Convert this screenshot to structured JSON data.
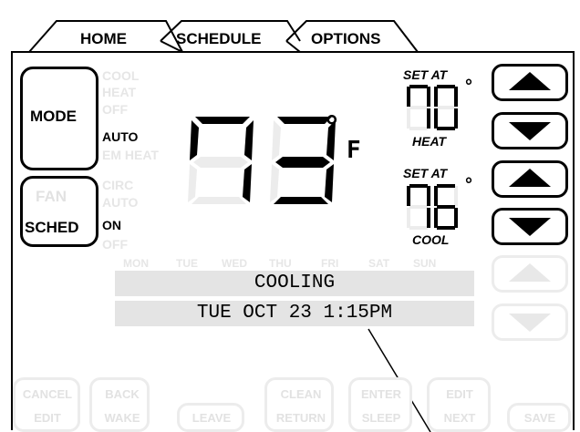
{
  "tabs": [
    {
      "label": "HOME"
    },
    {
      "label": "SCHEDULE"
    },
    {
      "label": "OPTIONS"
    }
  ],
  "mode": {
    "button_label": "MODE",
    "options": [
      "COOL",
      "HEAT",
      "OFF",
      "AUTO",
      "EM HEAT"
    ],
    "active": "AUTO"
  },
  "fan": {
    "button_label": "FAN",
    "options": [
      "CIRC",
      "AUTO",
      "ON",
      "OFF"
    ],
    "active": "ON"
  },
  "sched": {
    "button_label": "SCHED"
  },
  "temperature": {
    "current": "73",
    "degree_symbol": "°",
    "unit": "F"
  },
  "heat_setpoint": {
    "set_at_label": "SET AT",
    "value": "70",
    "degree_symbol": "°",
    "mode_label": "HEAT"
  },
  "cool_setpoint": {
    "set_at_label": "SET AT",
    "value": "76",
    "degree_symbol": "°",
    "mode_label": "COOL"
  },
  "days": [
    "MON",
    "TUE",
    "WED",
    "THU",
    "FRI",
    "SAT",
    "SUN"
  ],
  "status": {
    "line1": "COOLING",
    "line2": "TUE OCT 23 1:15PM"
  },
  "bottom_buttons": [
    {
      "line1": "CANCEL",
      "line2": "EDIT"
    },
    {
      "line1": "BACK",
      "line2": "WAKE"
    },
    {
      "line1": "",
      "line2": "LEAVE"
    },
    {
      "line1": "CLEAN",
      "line2": "RETURN"
    },
    {
      "line1": "ENTER",
      "line2": "SLEEP"
    },
    {
      "line1": "EDIT",
      "line2": "NEXT"
    },
    {
      "line1": "",
      "line2": "SAVE"
    }
  ],
  "icons": [
    "up-arrow-icon",
    "down-arrow-icon"
  ],
  "colors": {
    "active": "#000000",
    "inactive": "#e6e6e6",
    "status_bar": "#e4e4e4"
  }
}
